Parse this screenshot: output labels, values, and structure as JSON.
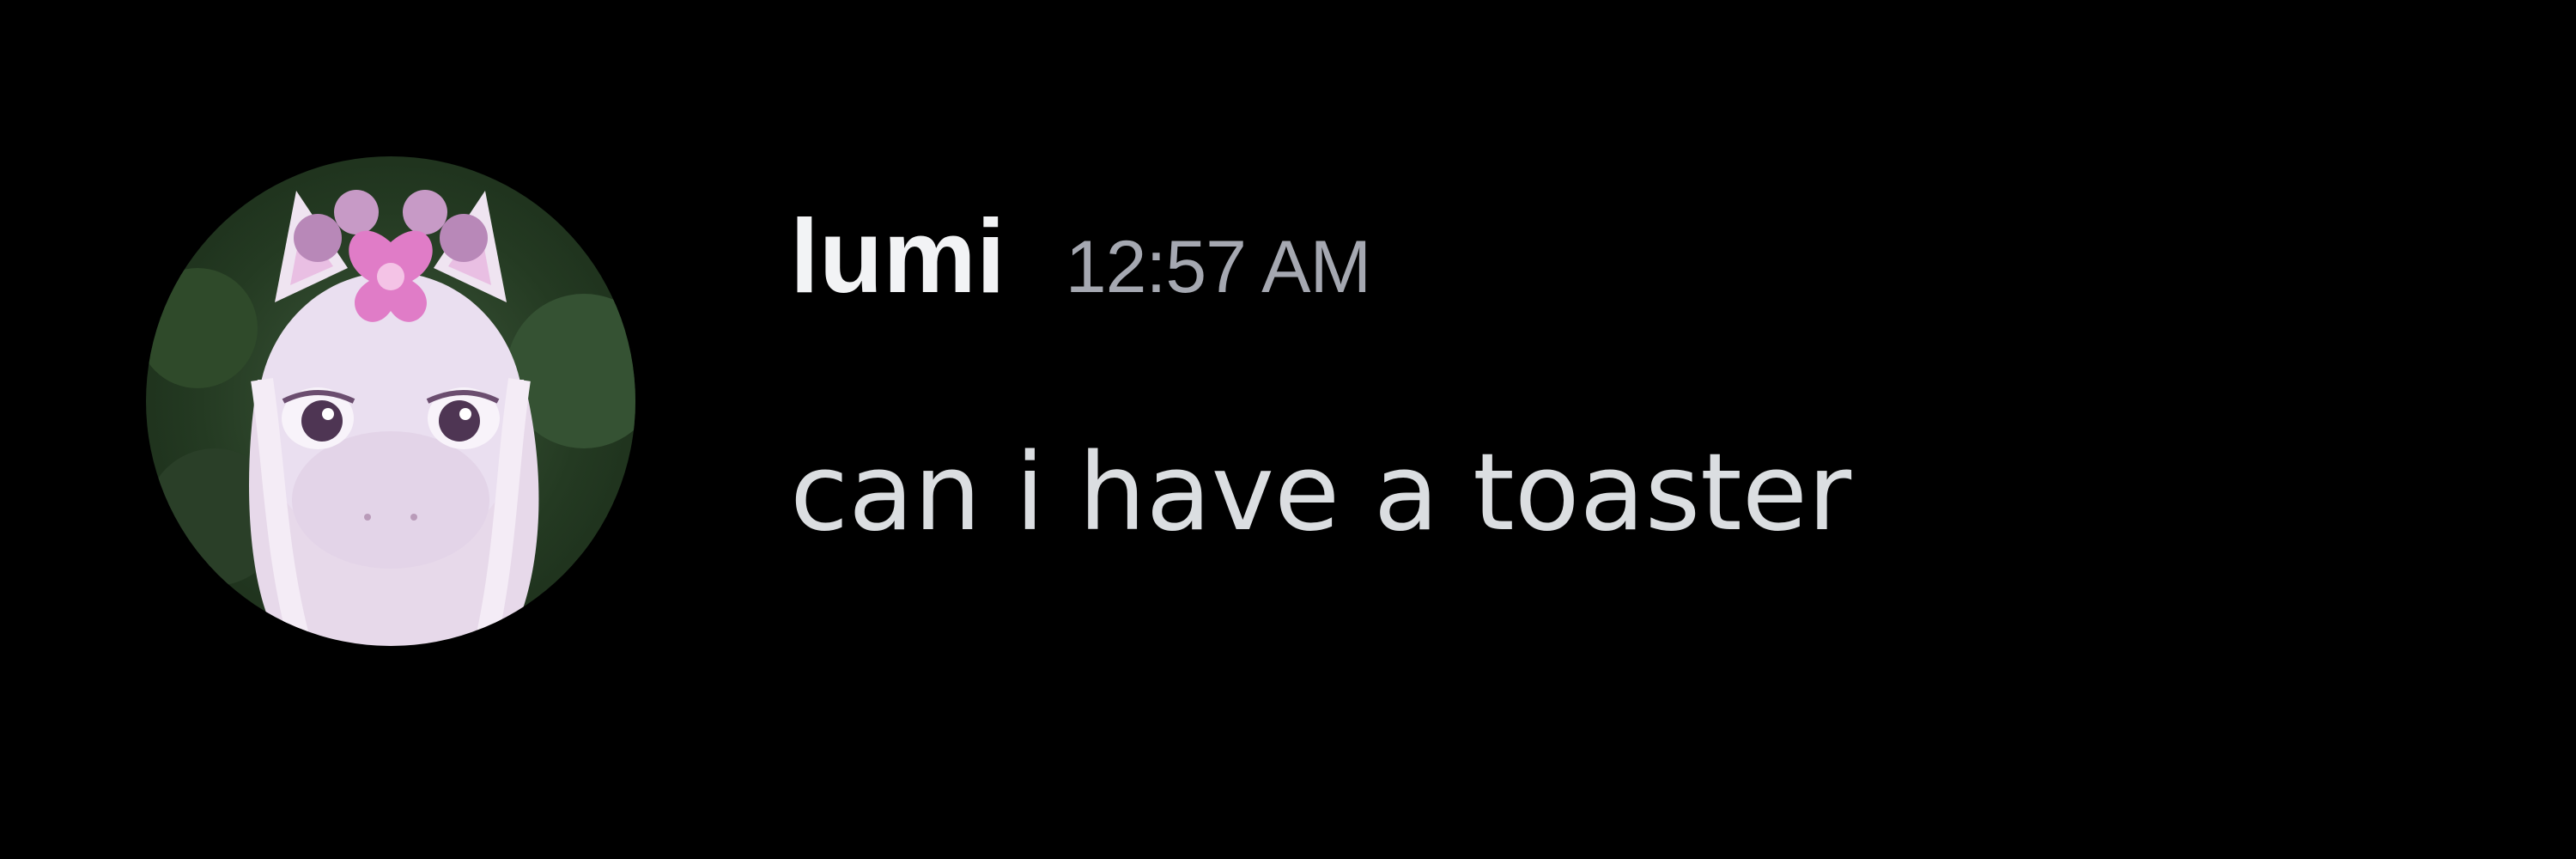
{
  "message": {
    "author": "lumi",
    "timestamp": "12:57 AM",
    "content": "can i have a toaster",
    "avatar_icon": "pony-avatar-icon"
  },
  "colors": {
    "background": "#000000",
    "username": "#f2f3f5",
    "timestamp": "#a5a8b1",
    "content": "#dbdee1"
  }
}
